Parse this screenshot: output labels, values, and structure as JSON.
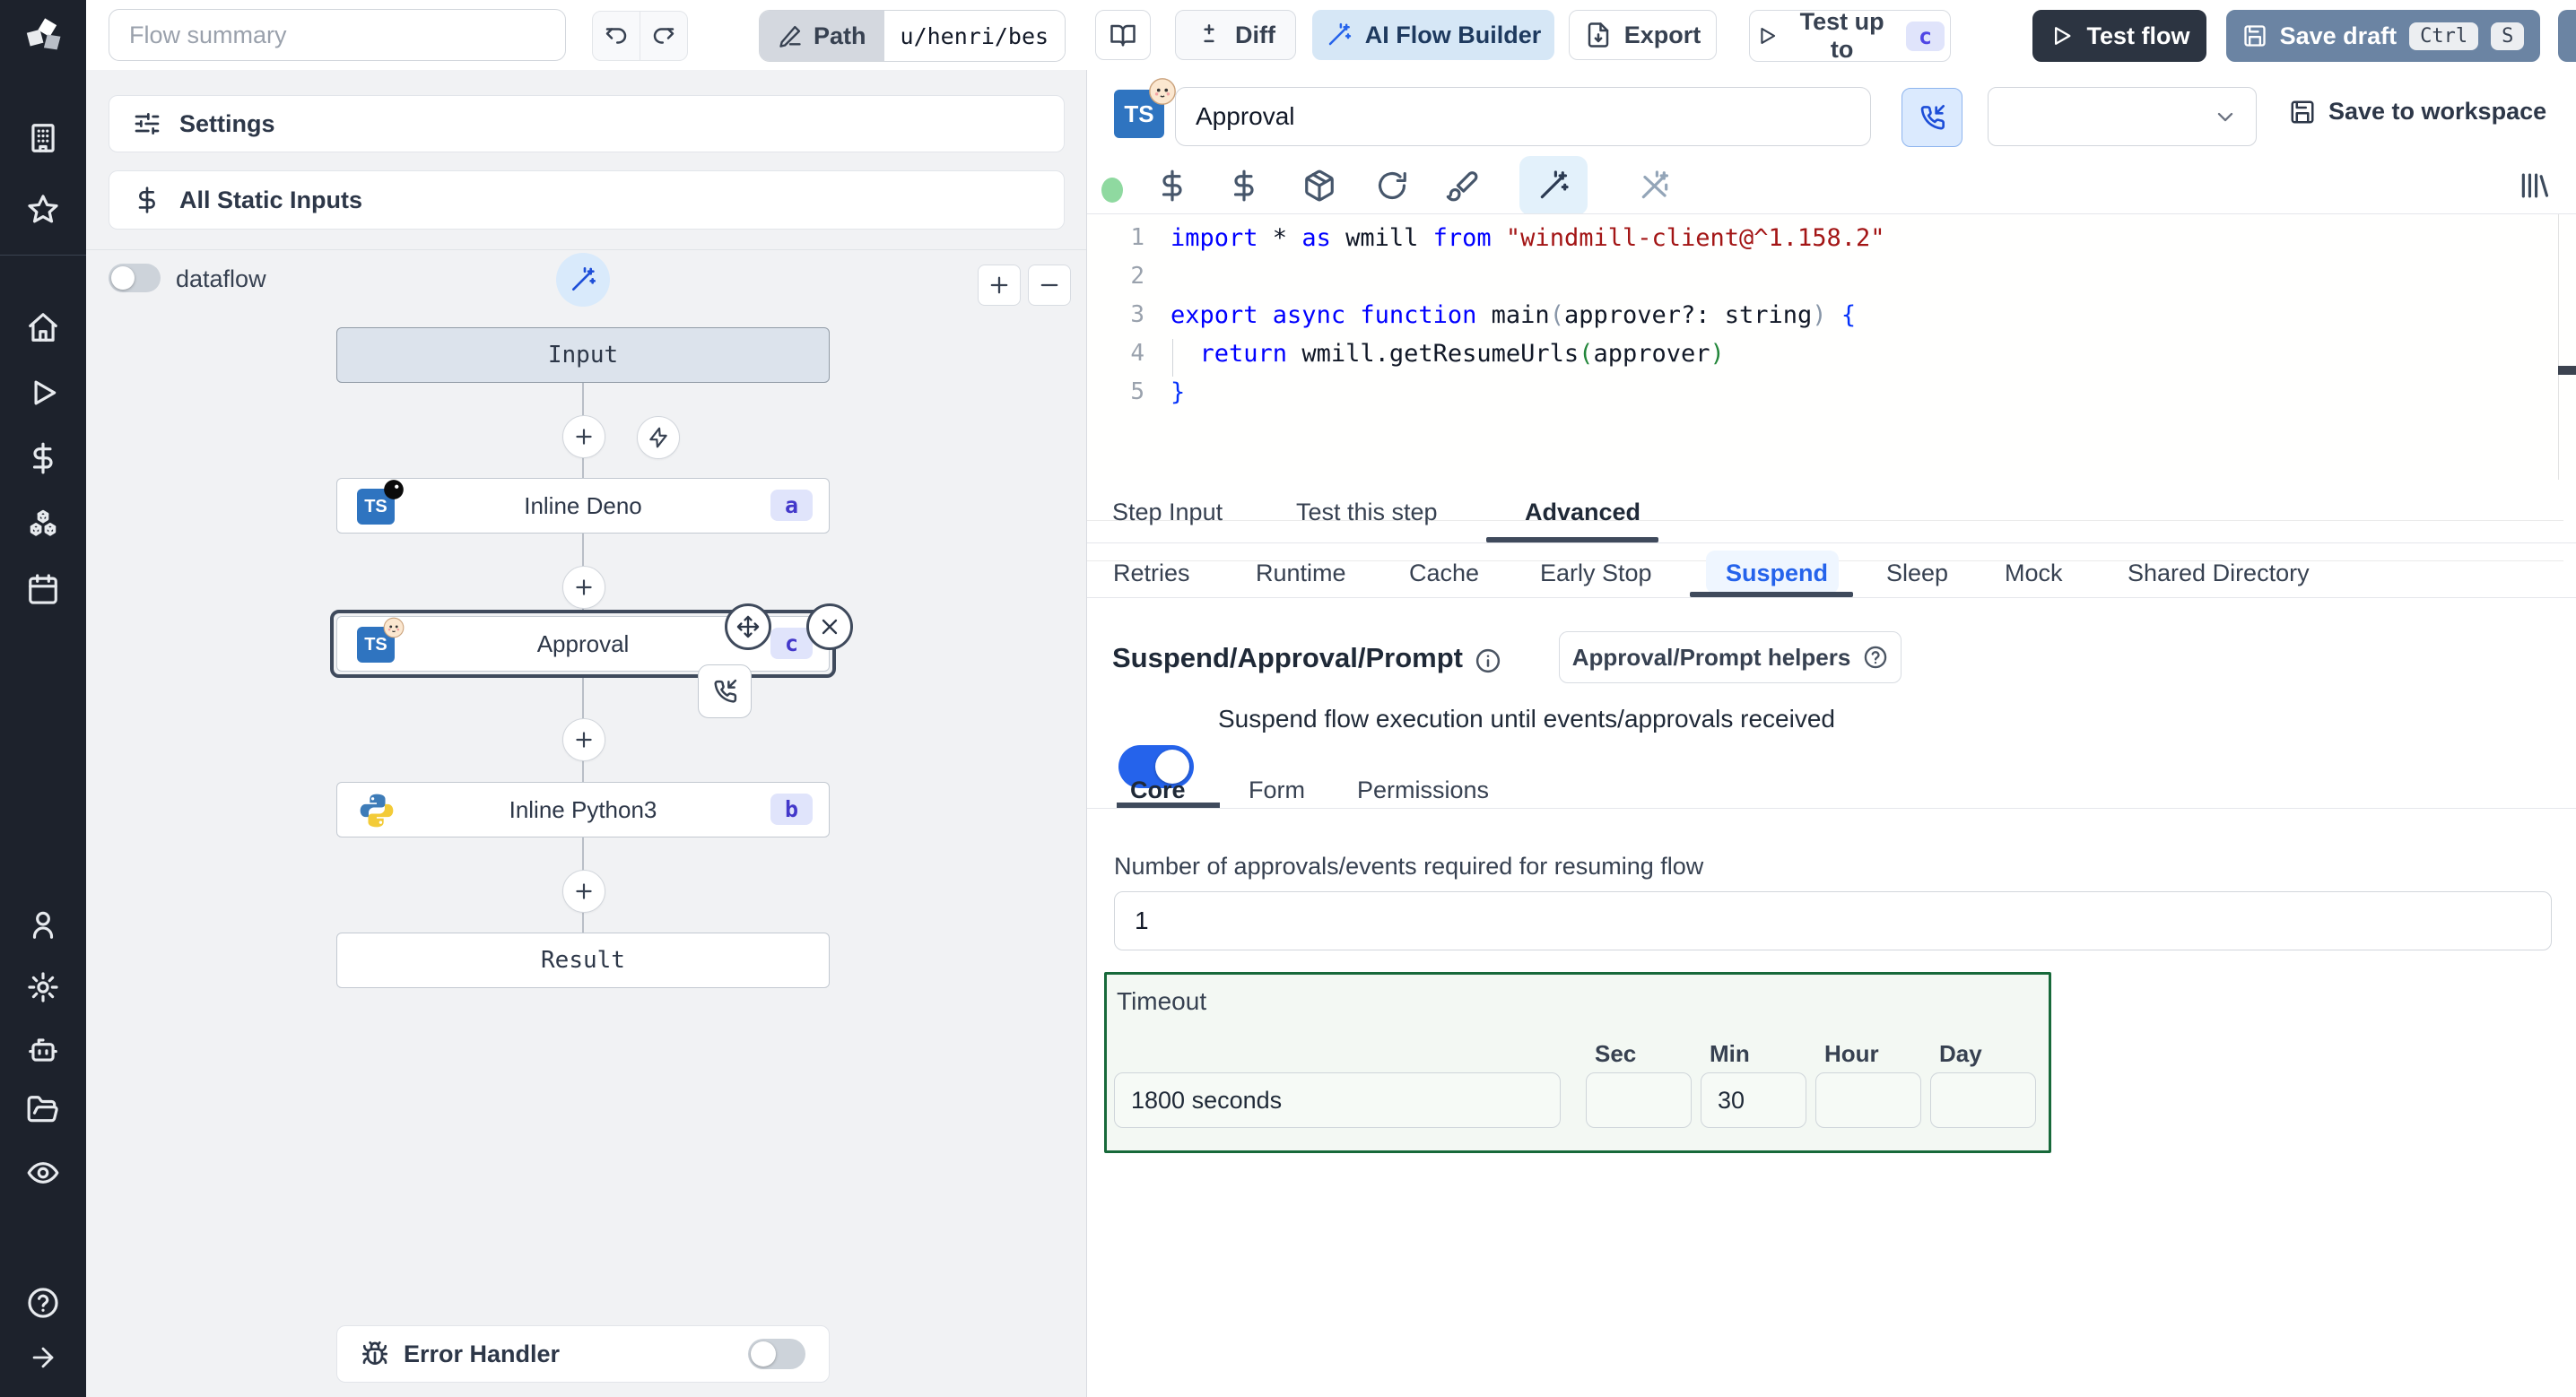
{
  "topbar": {
    "summary_placeholder": "Flow summary",
    "path_label": "Path",
    "path_value": "u/henri/bes",
    "diff_label": "Diff",
    "ai_builder_label": "AI Flow Builder",
    "export_label": "Export",
    "test_up_to_label": "Test up to",
    "test_up_to_badge": "c",
    "test_flow_label": "Test flow",
    "save_draft_label": "Save draft",
    "kbd_ctrl": "Ctrl",
    "kbd_s": "S"
  },
  "flow_panel": {
    "settings_label": "Settings",
    "static_inputs_label": "All Static Inputs",
    "dataflow_label": "dataflow",
    "zoom_in": "+",
    "zoom_out": "−",
    "nodes": {
      "input": {
        "label": "Input"
      },
      "deno": {
        "label": "Inline Deno",
        "badge": "a",
        "lang": "TS"
      },
      "approval": {
        "label": "Approval",
        "badge": "c",
        "lang": "TS"
      },
      "python": {
        "label": "Inline Python3",
        "badge": "b"
      },
      "result": {
        "label": "Result"
      }
    },
    "error_handler_label": "Error Handler"
  },
  "editor": {
    "step_name_value": "Approval",
    "lang": "TS",
    "save_to_workspace_label": "Save to workspace",
    "code": {
      "lines": [
        {
          "num": "1",
          "tokens": [
            {
              "t": "import ",
              "c": "kw"
            },
            {
              "t": "* ",
              "c": "pl"
            },
            {
              "t": "as ",
              "c": "kw"
            },
            {
              "t": "wmill ",
              "c": "pl"
            },
            {
              "t": "from ",
              "c": "kw"
            },
            {
              "t": "\"windmill-client@^1.158.2\"",
              "c": "str"
            }
          ]
        },
        {
          "num": "2",
          "tokens": []
        },
        {
          "num": "3",
          "tokens": [
            {
              "t": "export ",
              "c": "kw"
            },
            {
              "t": "async ",
              "c": "kw"
            },
            {
              "t": "function ",
              "c": "kw"
            },
            {
              "t": "main",
              "c": "pl"
            },
            {
              "t": "(",
              "c": "b1"
            },
            {
              "t": "approver?: string",
              "c": "pl"
            },
            {
              "t": ")",
              "c": "b1"
            },
            {
              "t": " {",
              "c": "b2"
            }
          ]
        },
        {
          "num": "4",
          "tokens": [
            {
              "t": "  return ",
              "c": "kw"
            },
            {
              "t": "wmill.getResumeUrls",
              "c": "pl"
            },
            {
              "t": "(",
              "c": "b3"
            },
            {
              "t": "approver",
              "c": "pl"
            },
            {
              "t": ")",
              "c": "b3"
            }
          ]
        },
        {
          "num": "5",
          "tokens": [
            {
              "t": "}",
              "c": "b2"
            }
          ]
        }
      ]
    }
  },
  "tabs": {
    "step": [
      "Step Input",
      "Test this step",
      "Advanced"
    ],
    "advanced": [
      "Retries",
      "Runtime",
      "Cache",
      "Early Stop",
      "Suspend",
      "Sleep",
      "Mock",
      "Shared Directory"
    ],
    "suspend_sub": [
      "Core",
      "Form",
      "Permissions"
    ]
  },
  "suspend": {
    "title": "Suspend/Approval/Prompt",
    "helpers_button_label": "Approval/Prompt helpers",
    "toggle_label": "Suspend flow execution until events/approvals received",
    "approvals_label": "Number of approvals/events required for resuming flow",
    "approvals_value": "1",
    "timeout": {
      "label": "Timeout",
      "total_value": "1800 seconds",
      "units": [
        "Sec",
        "Min",
        "Hour",
        "Day"
      ],
      "values": [
        "",
        "30",
        "",
        ""
      ]
    }
  },
  "colors": {
    "accent_blue": "#2563eb",
    "ai_button_bg": "#d6e7f6",
    "badge_bg": "#e0e4fb",
    "badge_text": "#4338ca",
    "timeout_border": "#17693a",
    "dark_button": "#2c3441",
    "save_draft_button": "#6b84a3",
    "status_dot": "#8fd9a0"
  }
}
